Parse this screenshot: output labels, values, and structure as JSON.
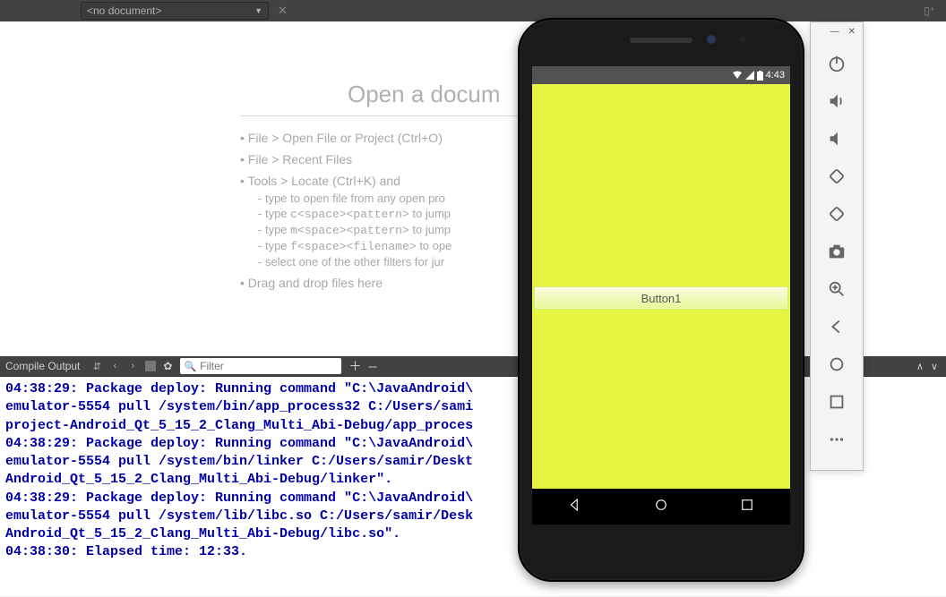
{
  "topbar": {
    "document": "<no document>",
    "close": "✕"
  },
  "welcome": {
    "title": "Open a docum",
    "items": [
      "File > Open File or Project (Ctrl+O)",
      "File > Recent Files",
      "Tools > Locate (Ctrl+K) and"
    ],
    "locate_sub": [
      "type to open file from any open pro",
      "type c<space><pattern> to jump",
      "type m<space><pattern> to jump",
      "type f<space><filename> to ope",
      "select one of the other filters for jur"
    ],
    "last": "Drag and drop files here"
  },
  "output_bar": {
    "title": "Compile Output",
    "filter_placeholder": "Filter"
  },
  "console_text": "04:38:29: Package deploy: Running command \"C:\\JavaAndroid\\               x\nemulator-5554 pull /system/bin/app_process32 C:/Users/sami                 d-\nproject-Android_Qt_5_15_2_Clang_Multi_Abi-Debug/app_proces\n04:38:29: Package deploy: Running command \"C:\\JavaAndroid\\\nemulator-5554 pull /system/bin/linker C:/Users/samir/Deskt                   ct-\nAndroid_Qt_5_15_2_Clang_Multi_Abi-Debug/linker\".\n04:38:29: Package deploy: Running command \"C:\\JavaAndroid\\               xe -s\nemulator-5554 pull /system/lib/libc.so C:/Users/samir/Desk               ld-project-\nAndroid_Qt_5_15_2_Clang_Multi_Abi-Debug/libc.so\".\n04:38:30: Elapsed time: 12:33.",
  "emulator": {
    "status_time": "4:43",
    "button_label": "Button1"
  }
}
